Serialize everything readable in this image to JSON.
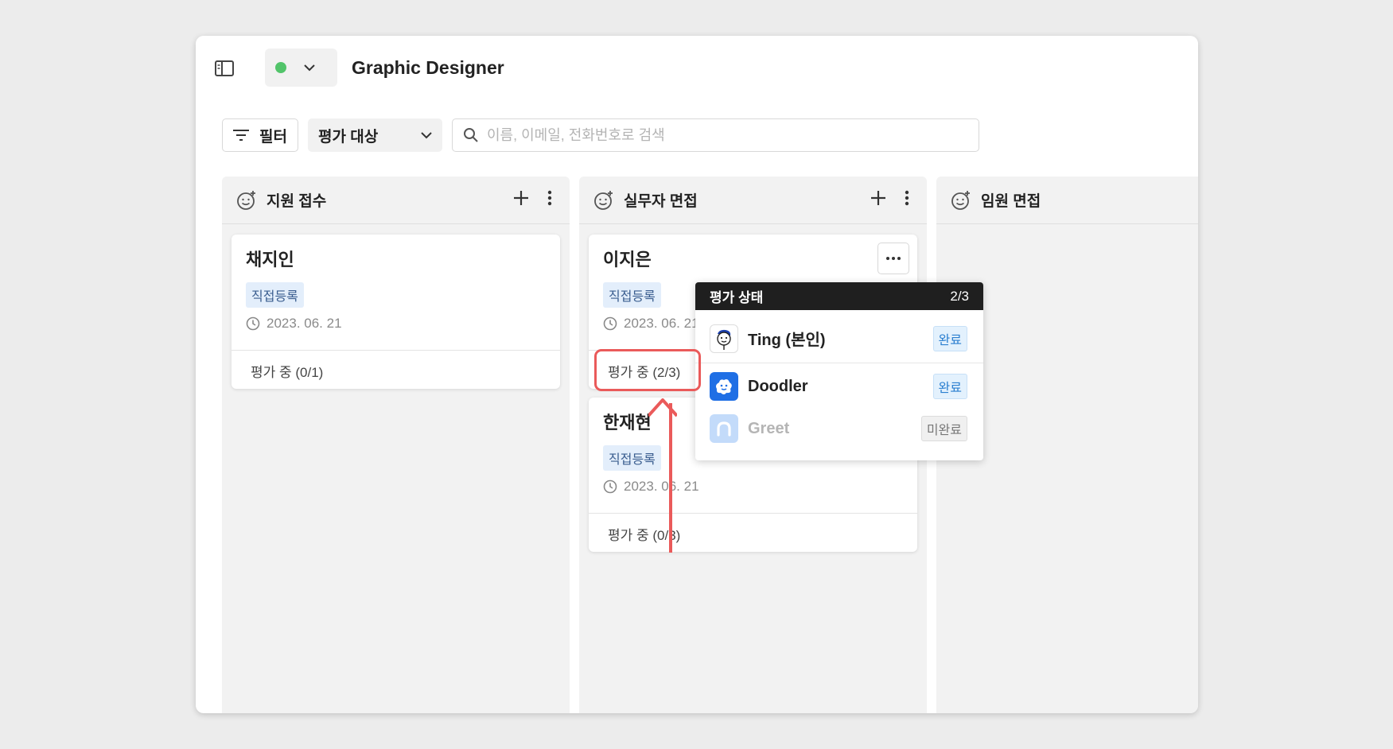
{
  "header": {
    "job_title": "Graphic Designer",
    "status_color": "#52c46a"
  },
  "toolbar": {
    "filter_label": "필터",
    "target_label": "평가 대상",
    "search_placeholder": "이름, 이메일, 전화번호로 검색"
  },
  "columns": [
    {
      "title": "지원 접수",
      "cards": [
        {
          "name": "채지인",
          "badge": "직접등록",
          "date": "2023. 06. 21",
          "progress": "평가 중 (0/1)"
        }
      ]
    },
    {
      "title": "실무자 면접",
      "cards": [
        {
          "name": "이지은",
          "badge": "직접등록",
          "date": "2023. 06. 21",
          "progress": "평가 중 (2/3)"
        },
        {
          "name": "한재현",
          "badge": "직접등록",
          "date": "2023. 06. 21",
          "progress": "평가 중 (0/3)"
        }
      ]
    },
    {
      "title": "임원 면접",
      "cards": []
    }
  ],
  "popover": {
    "title": "평가 상태",
    "count": "2/3",
    "evaluators": [
      {
        "name": "Ting (본인)",
        "status": "완료",
        "avatar_icon": "ting-avatar-icon"
      },
      {
        "name": "Doodler",
        "status": "완료",
        "avatar_icon": "doodler-avatar-icon"
      },
      {
        "name": "Greet",
        "status": "미완료",
        "avatar_icon": "greet-avatar-icon"
      }
    ]
  },
  "colors": {
    "accent_red": "#ea5a5a",
    "done_blue": "#2b7fd0",
    "doodler_blue": "#1f6fe5"
  }
}
